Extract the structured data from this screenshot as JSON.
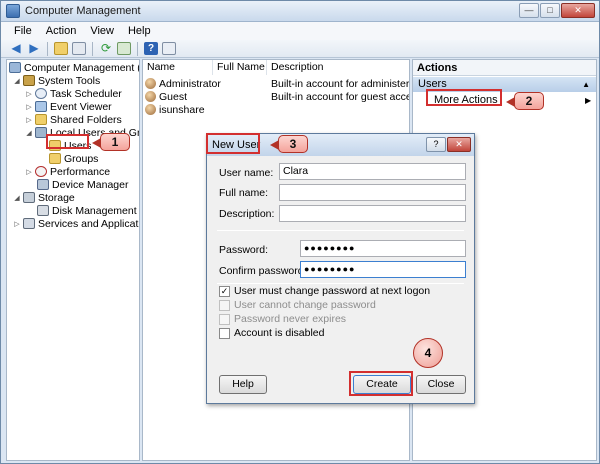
{
  "window": {
    "title": "Computer Management",
    "controls": {
      "minimize": "—",
      "maximize": "□",
      "close": "✕"
    }
  },
  "menu": [
    "File",
    "Action",
    "View",
    "Help"
  ],
  "toolbar": {
    "icons": [
      "back-arrow-icon",
      "forward-arrow-icon",
      "up-folder-icon",
      "show-tree-icon",
      "refresh-icon",
      "export-icon",
      "help-icon",
      "properties-icon"
    ]
  },
  "tree": {
    "root": "Computer Management (Local",
    "system_tools": "System Tools",
    "task_scheduler": "Task Scheduler",
    "event_viewer": "Event Viewer",
    "shared_folders": "Shared Folders",
    "local_users_groups": "Local Users and Groups",
    "users": "Users",
    "groups": "Groups",
    "performance": "Performance",
    "device_manager": "Device Manager",
    "storage": "Storage",
    "disk_management": "Disk Management",
    "services_apps": "Services and Applications"
  },
  "list": {
    "headers": {
      "name": "Name",
      "full_name": "Full Name",
      "description": "Description"
    },
    "rows": [
      {
        "name": "Administrator",
        "full_name": "",
        "description": "Built-in account for administering..."
      },
      {
        "name": "Guest",
        "full_name": "",
        "description": "Built-in account for guest access t..."
      },
      {
        "name": "isunshare",
        "full_name": "",
        "description": ""
      }
    ]
  },
  "actions": {
    "header": "Actions",
    "section": "Users",
    "more_actions": "More Actions"
  },
  "dialog": {
    "title": "New User",
    "help_glyph": "?",
    "close_glyph": "✕",
    "labels": {
      "user_name": "User name:",
      "full_name": "Full name:",
      "description": "Description:",
      "password": "Password:",
      "confirm_password": "Confirm password:"
    },
    "values": {
      "user_name": "Clara",
      "full_name": "",
      "description": "",
      "password": "●●●●●●●●",
      "confirm_password": "●●●●●●●●"
    },
    "checkboxes": {
      "must_change": {
        "label": "User must change password at next logon",
        "checked": true,
        "enabled": true
      },
      "cannot_change": {
        "label": "User cannot change password",
        "checked": false,
        "enabled": false
      },
      "never_expires": {
        "label": "Password never expires",
        "checked": false,
        "enabled": false
      },
      "disabled": {
        "label": "Account is disabled",
        "checked": false,
        "enabled": true
      }
    },
    "buttons": {
      "help": "Help",
      "create": "Create",
      "close": "Close"
    }
  },
  "callouts": {
    "c1": "1",
    "c2": "2",
    "c3": "3",
    "c4": "4"
  },
  "colors": {
    "highlight": "#d32f2f",
    "callout_fill": "#f4a39b",
    "selection": "#3399ff"
  }
}
